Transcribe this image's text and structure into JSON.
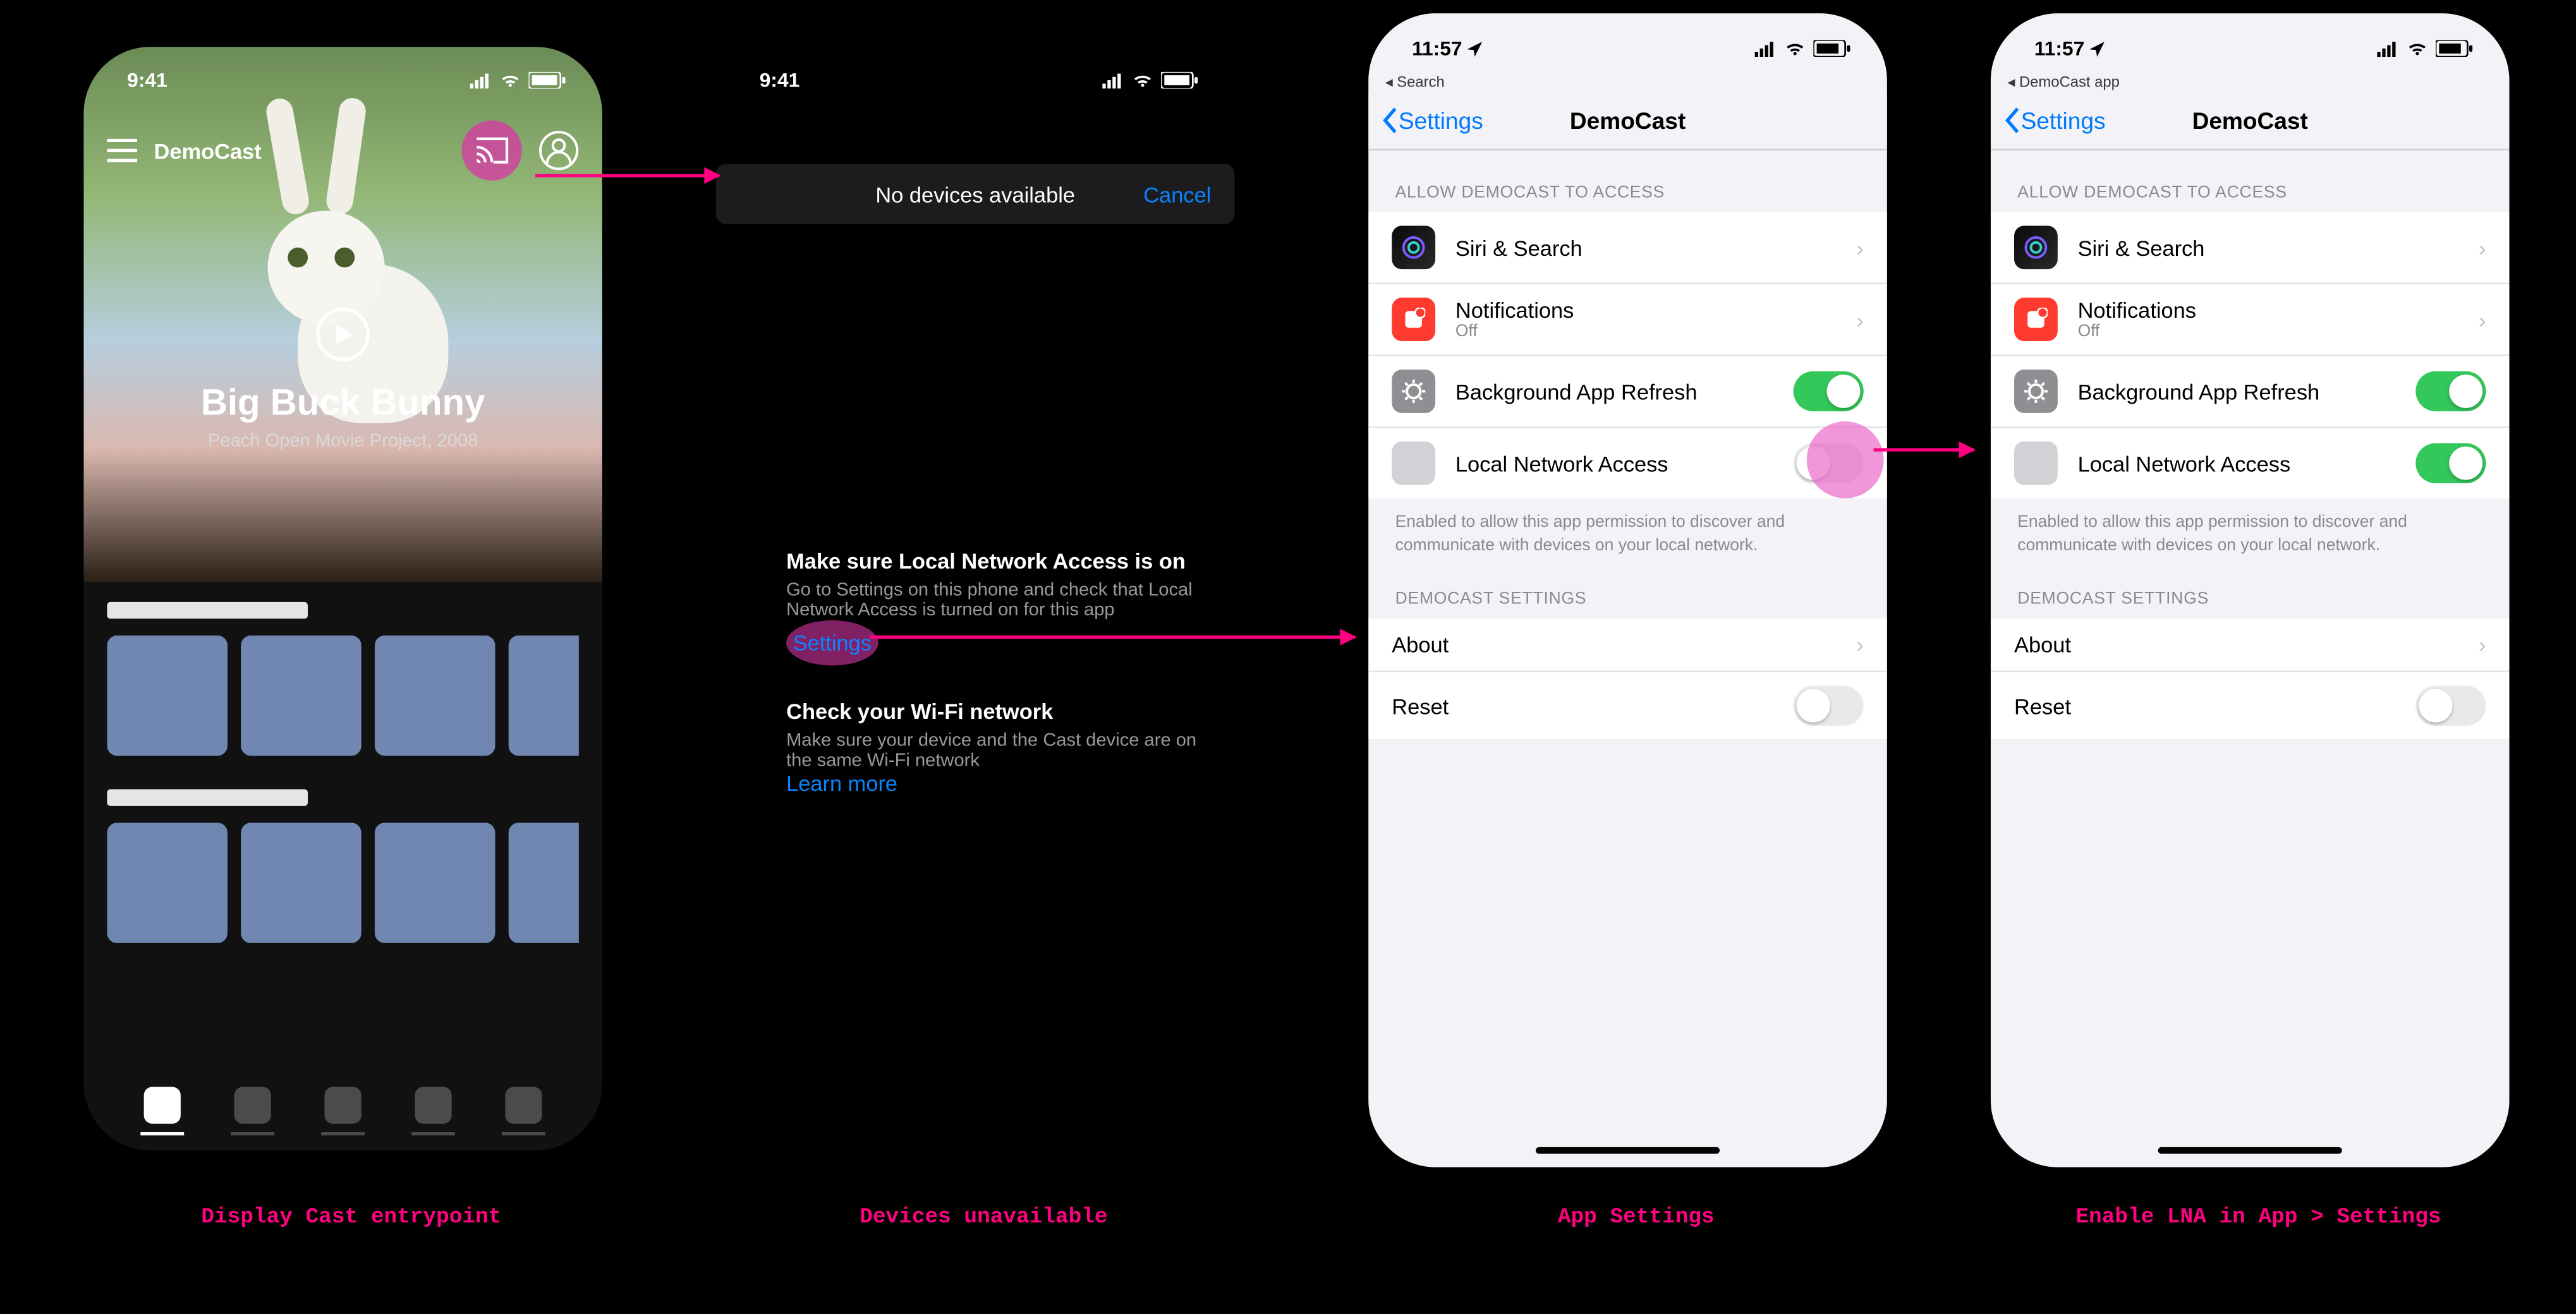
{
  "captions": {
    "p1": "Display Cast entrypoint",
    "p2": "Devices unavailable",
    "p3": "App Settings",
    "p4": "Enable LNA in App > Settings"
  },
  "statusbar": {
    "time_demo": "9:41",
    "time_live": "11:57"
  },
  "p1": {
    "app_title": "DemoCast",
    "hero_title": "Big Buck Bunny",
    "hero_subtitle": "Peach Open Movie Project, 2008"
  },
  "p2": {
    "sheet_title": "No devices available",
    "cancel": "Cancel",
    "tip1_title": "Make sure Local Network Access is on",
    "tip1_body": "Go to Settings on this phone and check that Local Network Access is turned on for this app",
    "tip1_link": "Settings",
    "tip2_title": "Check your Wi-Fi network",
    "tip2_body": "Make sure your device and the Cast device are on the same Wi-Fi network",
    "tip2_link": "Learn more"
  },
  "settings_common": {
    "back_label": "Settings",
    "page_title": "DemoCast",
    "section_access": "ALLOW DEMOCAST TO ACCESS",
    "row_siri": "Siri & Search",
    "row_notif": "Notifications",
    "row_notif_sub": "Off",
    "row_bg": "Background App Refresh",
    "row_lna": "Local Network Access",
    "lna_footer": "Enabled to allow this app permission to discover and communicate with devices on your local network.",
    "section_app": "DEMOCAST SETTINGS",
    "row_about": "About",
    "row_reset": "Reset"
  },
  "p3": {
    "breadcrumb": "◂ Search",
    "lna_on": false
  },
  "p4": {
    "breadcrumb": "◂ DemoCast app",
    "lna_on": true
  }
}
